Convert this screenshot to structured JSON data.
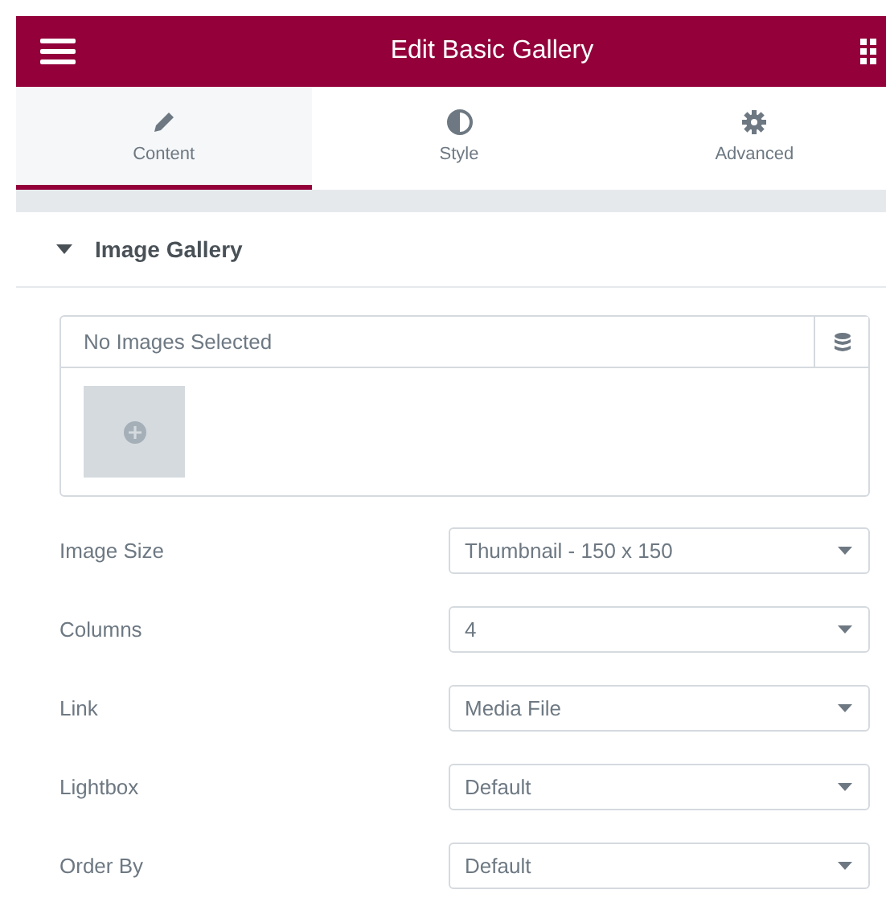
{
  "header": {
    "title": "Edit Basic Gallery"
  },
  "tabs": [
    {
      "label": "Content",
      "selected": true
    },
    {
      "label": "Style",
      "selected": false
    },
    {
      "label": "Advanced",
      "selected": false
    }
  ],
  "section": {
    "title": "Image Gallery",
    "expanded": true
  },
  "gallery": {
    "placeholder": "No Images Selected"
  },
  "fields": [
    {
      "label": "Image Size",
      "value": "Thumbnail - 150 x 150"
    },
    {
      "label": "Columns",
      "value": "4"
    },
    {
      "label": "Link",
      "value": "Media File"
    },
    {
      "label": "Lightbox",
      "value": "Default"
    },
    {
      "label": "Order By",
      "value": "Default"
    }
  ]
}
